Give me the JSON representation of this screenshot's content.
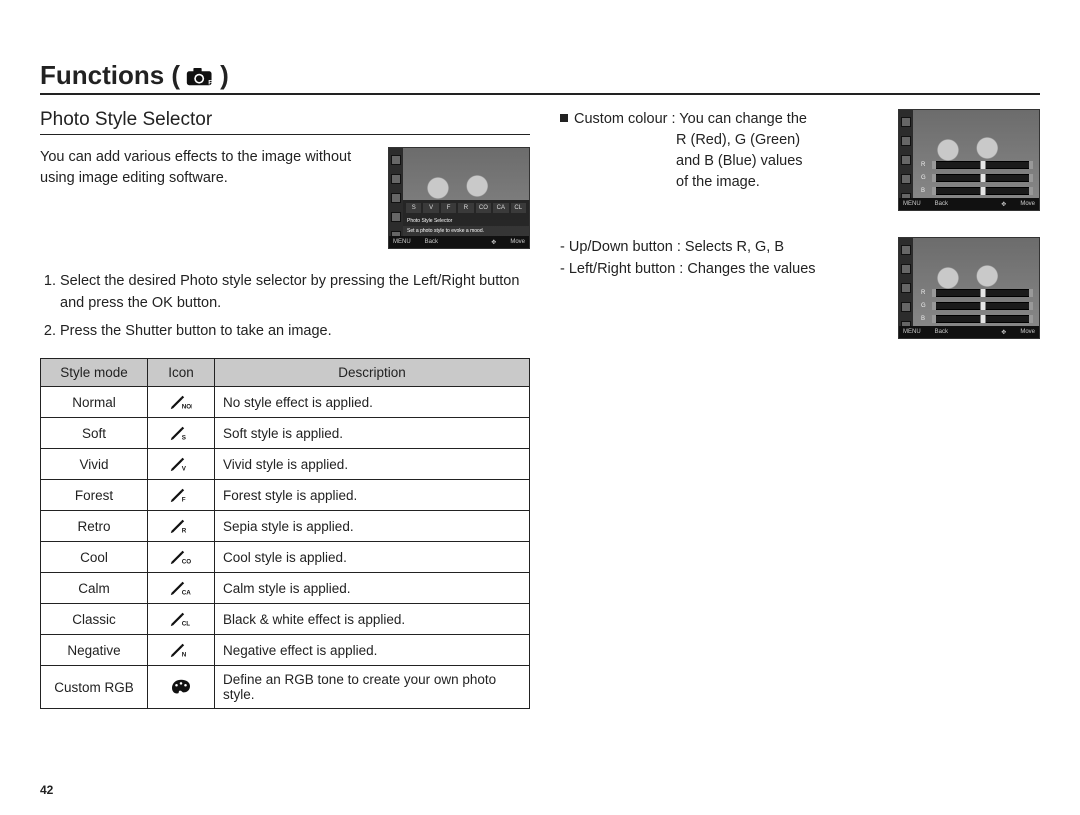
{
  "page": {
    "title_prefix": "Functions (",
    "title_suffix": " )",
    "page_number": "42"
  },
  "left": {
    "subheading": "Photo Style Selector",
    "intro": "You can add various effects to the image without using image editing software.",
    "screenshot": {
      "strip_icons_count": 5,
      "selector_labels": [
        "S",
        "V",
        "F",
        "R",
        "CO",
        "CA",
        "CL"
      ],
      "caption_line1": "Photo Style Selector",
      "caption_line2": "Set a photo style to evoke a mood.",
      "back_label": "Back",
      "move_label": "Move",
      "menu_label": "MENU"
    },
    "steps": [
      "Select the desired Photo style selector by pressing the Left/Right button and press the OK button.",
      "Press the Shutter button to take an image."
    ],
    "table": {
      "headers": {
        "mode": "Style mode",
        "icon": "Icon",
        "desc": "Description"
      },
      "rows": [
        {
          "mode": "Normal",
          "icon_sub": "NOR",
          "desc": "No style effect is applied."
        },
        {
          "mode": "Soft",
          "icon_sub": "S",
          "desc": "Soft style is applied."
        },
        {
          "mode": "Vivid",
          "icon_sub": "V",
          "desc": "Vivid style is applied."
        },
        {
          "mode": "Forest",
          "icon_sub": "F",
          "desc": "Forest style is applied."
        },
        {
          "mode": "Retro",
          "icon_sub": "R",
          "desc": "Sepia style is applied."
        },
        {
          "mode": "Cool",
          "icon_sub": "CO",
          "desc": "Cool style is applied."
        },
        {
          "mode": "Calm",
          "icon_sub": "CA",
          "desc": "Calm style is applied."
        },
        {
          "mode": "Classic",
          "icon_sub": "CL",
          "desc": "Black & white effect is applied."
        },
        {
          "mode": "Negative",
          "icon_sub": "N",
          "desc": "Negative effect is applied."
        },
        {
          "mode": "Custom RGB",
          "icon_sub": "",
          "desc": "Define an RGB tone to create your own photo style.",
          "palette": true
        }
      ]
    }
  },
  "right": {
    "custom_label": "Custom colour : You can change the",
    "custom_line2": "R (Red), G (Green)",
    "custom_line3": "and B (Blue) values",
    "custom_line4": "of the image.",
    "controls": [
      "- Up/Down button : Selects R, G, B",
      "- Left/Right button : Changes the values"
    ],
    "sliders": [
      "R",
      "G",
      "B"
    ],
    "screenshot_refs": {
      "back_label": "Back",
      "move_label": "Move",
      "menu_label": "MENU"
    }
  }
}
